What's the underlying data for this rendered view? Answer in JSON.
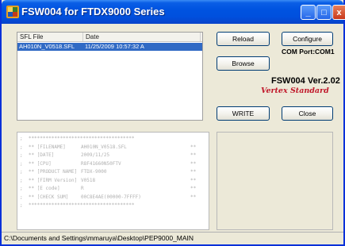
{
  "window": {
    "title": "FSW004 for FTDX9000 Series",
    "minimize_symbol": "_",
    "maximize_symbol": "□",
    "close_symbol": "x"
  },
  "file_list": {
    "columns": [
      "SFL File",
      "Date"
    ],
    "rows": [
      {
        "file": "AH010N_V0518.SFL",
        "date": "11/25/2009 10:57:32 A"
      }
    ]
  },
  "buttons": {
    "reload": "Reload",
    "configure": "Configure",
    "browse": "Browse",
    "write": "WRITE",
    "close": "Close"
  },
  "com_port": "COM Port:COM1",
  "version": "FSW004 Ver.2.02",
  "brand": "Vertex Standard",
  "info": {
    "border_line": ";  *************************************",
    "rows": [
      {
        "key": ";  ** [FILENAME]",
        "value": "AH010N_V0518.SFL",
        "end": "**"
      },
      {
        "key": ";  ** [DATE]",
        "value": "2009/11/25",
        "end": "**"
      },
      {
        "key": ";  ** [CPU]",
        "value": "R8F41660N50FTV",
        "end": "**"
      },
      {
        "key": ";  ** [PRODUCT NAME]",
        "value": "FTDX-9000",
        "end": "**"
      },
      {
        "key": ";  ** [FIRM Version]",
        "value": "V0518",
        "end": "**"
      },
      {
        "key": ";  ** [E code]",
        "value": "R",
        "end": "**"
      },
      {
        "key": ";  ** [CHECK SUM]",
        "value": "00C8E4AE(00000-7FFFF)",
        "end": "**"
      }
    ]
  },
  "status_path": "C:\\Documents and Settings\\mmaruya\\Desktop\\PEP9000_MAIN"
}
